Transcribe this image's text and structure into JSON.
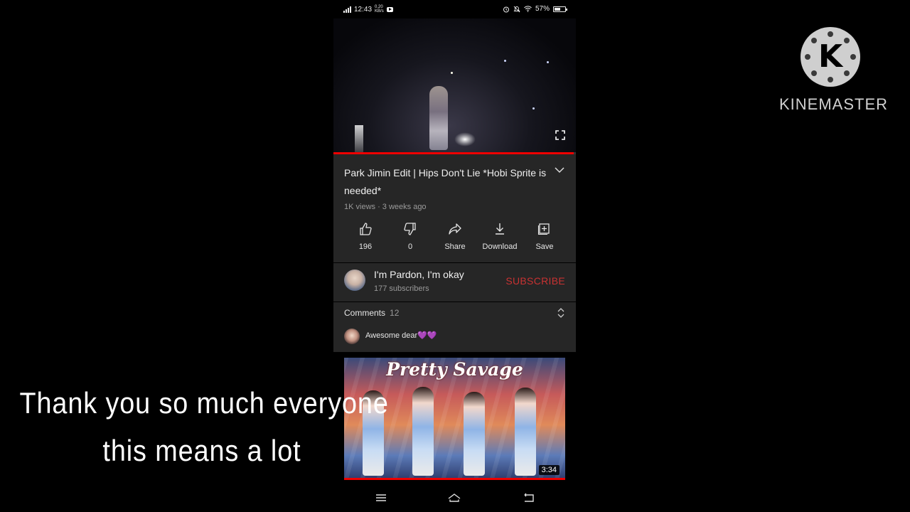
{
  "status_bar": {
    "time": "12:43",
    "data_speed_top": "0.20",
    "data_speed_bottom": "KB/s",
    "battery": "57%",
    "battery_level": 0.57
  },
  "video": {
    "progress": 0.99
  },
  "details": {
    "title": "Park Jimin Edit | Hips Don't Lie *Hobi Sprite is needed*",
    "meta": "1K views · 3 weeks ago"
  },
  "actions": [
    {
      "icon": "thumbs-up-icon",
      "label": "196"
    },
    {
      "icon": "thumbs-down-icon",
      "label": "0"
    },
    {
      "icon": "share-icon",
      "label": "Share"
    },
    {
      "icon": "download-icon",
      "label": "Download"
    },
    {
      "icon": "save-icon",
      "label": "Save"
    }
  ],
  "channel": {
    "name": "I'm Pardon, I'm okay",
    "subscribers": "177 subscribers",
    "subscribe_label": "SUBSCRIBE",
    "subscribe_color": "#c83232"
  },
  "comments": {
    "label": "Comments",
    "count": "12",
    "top_comment_text": "Awesome dear",
    "top_comment_emoji": "💜💜"
  },
  "recommended": {
    "thumbnail_title": "Pretty Savage",
    "duration": "3:34"
  },
  "caption": {
    "line1": "Thank you so much everyone",
    "line2": "this means a lot"
  },
  "watermark": {
    "letter": "K",
    "brand": "KINEMASTER"
  },
  "colors": {
    "accent_red": "#ee0000",
    "panel": "#262626",
    "background": "#000000"
  }
}
